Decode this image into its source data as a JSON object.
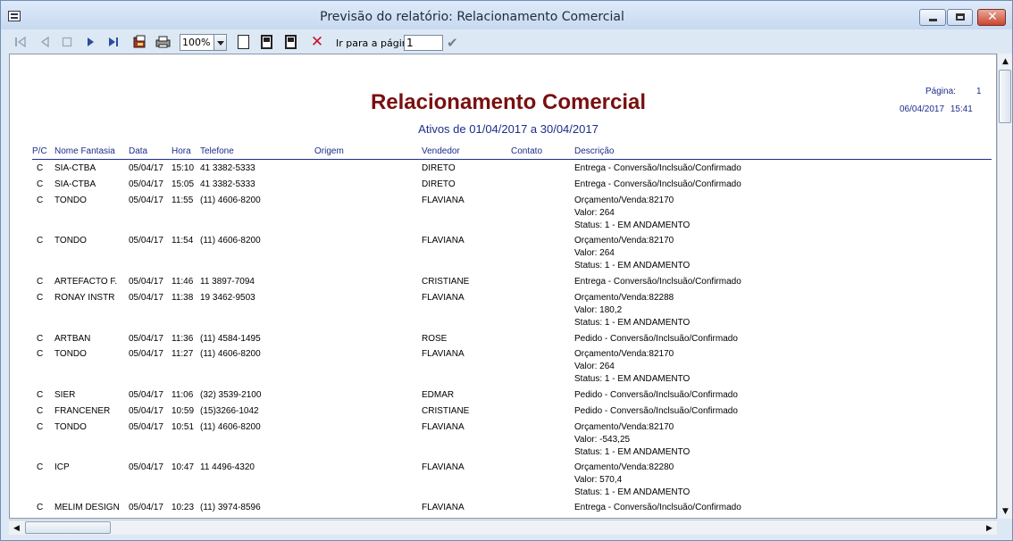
{
  "window": {
    "title": "Previsão do relatório: Relacionamento Comercial"
  },
  "toolbar": {
    "zoom": "100%",
    "goto_label": "Ir para a página",
    "goto_value": "1"
  },
  "report": {
    "title": "Relacionamento Comercial",
    "subtitle": "Ativos de 01/04/2017 a 30/04/2017",
    "page_label": "Página:",
    "page_number": "1",
    "date": "06/04/2017",
    "time": "15:41",
    "columns": [
      "P/C",
      "Nome Fantasia",
      "Data",
      "Hora",
      "Telefone",
      "Origem",
      "Vendedor",
      "Contato",
      "Descrição"
    ],
    "rows": [
      {
        "pc": "C",
        "nome": "SIA-CTBA",
        "data": "05/04/17",
        "hora": "15:10",
        "tel": "41 3382-5333",
        "vend": "DIRETO",
        "desc": [
          "Entrega - Conversão/Inclsuão/Confirmado"
        ]
      },
      {
        "pc": "C",
        "nome": "SIA-CTBA",
        "data": "05/04/17",
        "hora": "15:05",
        "tel": "41 3382-5333",
        "vend": "DIRETO",
        "desc": [
          "Entrega - Conversão/Inclsuão/Confirmado"
        ]
      },
      {
        "pc": "C",
        "nome": "TONDO",
        "data": "05/04/17",
        "hora": "11:55",
        "tel": "(11) 4606-8200",
        "vend": "FLAVIANA",
        "desc": [
          "Orçamento/Venda:82170",
          "Valor: 264",
          "Status: 1 - EM ANDAMENTO"
        ]
      },
      {
        "pc": "C",
        "nome": "TONDO",
        "data": "05/04/17",
        "hora": "11:54",
        "tel": "(11) 4606-8200",
        "vend": "FLAVIANA",
        "desc": [
          "Orçamento/Venda:82170",
          "Valor: 264",
          "Status: 1 - EM ANDAMENTO"
        ]
      },
      {
        "pc": "C",
        "nome": "ARTEFACTO F.",
        "data": "05/04/17",
        "hora": "11:46",
        "tel": "11 3897-7094",
        "vend": "CRISTIANE",
        "desc": [
          "Entrega - Conversão/Inclsuão/Confirmado"
        ]
      },
      {
        "pc": "C",
        "nome": "RONAY INSTR",
        "data": "05/04/17",
        "hora": "11:38",
        "tel": "19 3462-9503",
        "vend": "FLAVIANA",
        "desc": [
          "Orçamento/Venda:82288",
          "Valor: 180,2",
          "Status: 1 - EM ANDAMENTO"
        ]
      },
      {
        "pc": "C",
        "nome": "ARTBAN",
        "data": "05/04/17",
        "hora": "11:36",
        "tel": "(11) 4584-1495",
        "vend": "ROSE",
        "desc": [
          "Pedido - Conversão/Inclsuão/Confirmado"
        ]
      },
      {
        "pc": "C",
        "nome": "TONDO",
        "data": "05/04/17",
        "hora": "11:27",
        "tel": "(11) 4606-8200",
        "vend": "FLAVIANA",
        "desc": [
          "Orçamento/Venda:82170",
          "Valor: 264",
          "Status: 1 - EM ANDAMENTO"
        ]
      },
      {
        "pc": "C",
        "nome": "SIER",
        "data": "05/04/17",
        "hora": "11:06",
        "tel": "(32) 3539-2100",
        "vend": "EDMAR",
        "desc": [
          "Pedido - Conversão/Inclsuão/Confirmado"
        ]
      },
      {
        "pc": "C",
        "nome": "FRANCENER",
        "data": "05/04/17",
        "hora": "10:59",
        "tel": "(15)3266-1042",
        "vend": "CRISTIANE",
        "desc": [
          "Pedido - Conversão/Inclsuão/Confirmado"
        ]
      },
      {
        "pc": "C",
        "nome": "TONDO",
        "data": "05/04/17",
        "hora": "10:51",
        "tel": "(11) 4606-8200",
        "vend": "FLAVIANA",
        "desc": [
          "Orçamento/Venda:82170",
          "Valor: -543,25",
          "Status: 1 - EM ANDAMENTO"
        ]
      },
      {
        "pc": "C",
        "nome": "ICP",
        "data": "05/04/17",
        "hora": "10:47",
        "tel": "11 4496-4320",
        "vend": "FLAVIANA",
        "desc": [
          "Orçamento/Venda:82280",
          "Valor: 570,4",
          "Status: 1 - EM ANDAMENTO"
        ]
      },
      {
        "pc": "C",
        "nome": "MELIM DESIGN",
        "data": "05/04/17",
        "hora": "10:23",
        "tel": "(11) 3974-8596",
        "vend": "FLAVIANA",
        "desc": [
          "Entrega - Conversão/Inclsuão/Confirmado"
        ]
      }
    ]
  }
}
